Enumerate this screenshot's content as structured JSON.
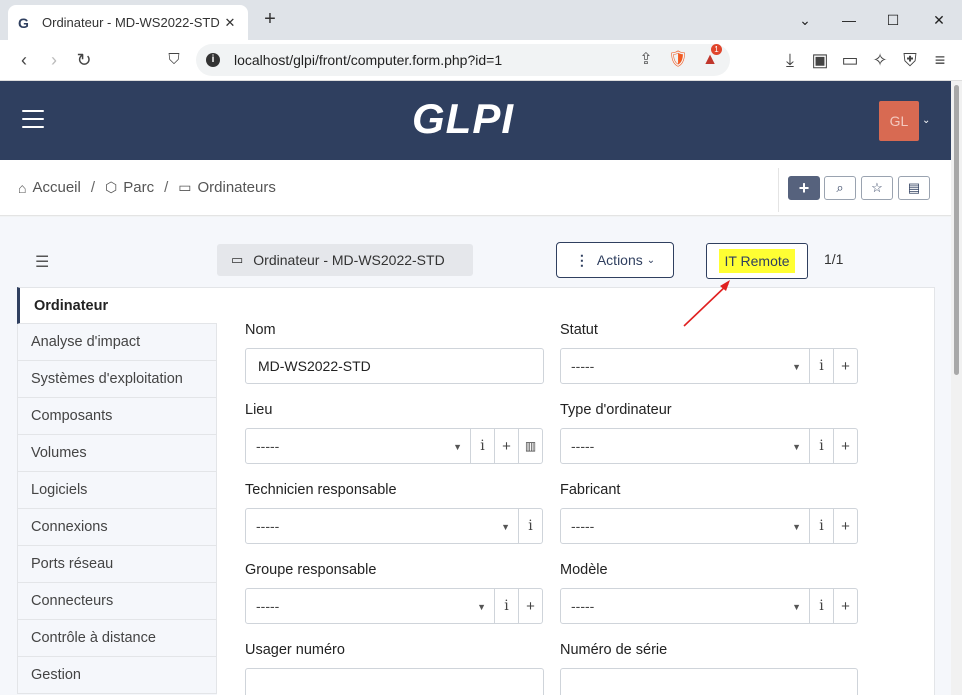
{
  "browser": {
    "tab_title": "Ordinateur - MD-WS2022-STD -",
    "url": "localhost/glpi/front/computer.form.php?id=1",
    "brave_badge": "1"
  },
  "header": {
    "logo": "GLPI",
    "avatar_initials": "GL"
  },
  "breadcrumb": {
    "items": [
      "Accueil",
      "Parc",
      "Ordinateurs"
    ]
  },
  "item": {
    "name": "Ordinateur - MD-WS2022-STD",
    "actions_label": "Actions",
    "it_remote_label": "IT Remote",
    "pager": "1/1"
  },
  "tabs": [
    "Ordinateur",
    "Analyse d'impact",
    "Systèmes d'exploitation",
    "Composants",
    "Volumes",
    "Logiciels",
    "Connexions",
    "Ports réseau",
    "Connecteurs",
    "Contrôle à distance",
    "Gestion"
  ],
  "form": {
    "nom_label": "Nom",
    "nom_value": "MD-WS2022-STD",
    "statut_label": "Statut",
    "statut_value": "-----",
    "lieu_label": "Lieu",
    "lieu_value": "-----",
    "type_label": "Type d'ordinateur",
    "type_value": "-----",
    "tech_label": "Technicien responsable",
    "tech_value": "-----",
    "fabricant_label": "Fabricant",
    "fabricant_value": "-----",
    "groupe_label": "Groupe responsable",
    "groupe_value": "-----",
    "modele_label": "Modèle",
    "modele_value": "-----",
    "usager_label": "Usager numéro",
    "serie_label": "Numéro de série"
  },
  "colors": {
    "header_bg": "#2f3f5f",
    "avatar_bg": "#d86a52",
    "highlight": "#ffff33",
    "arrow": "#e02020"
  }
}
